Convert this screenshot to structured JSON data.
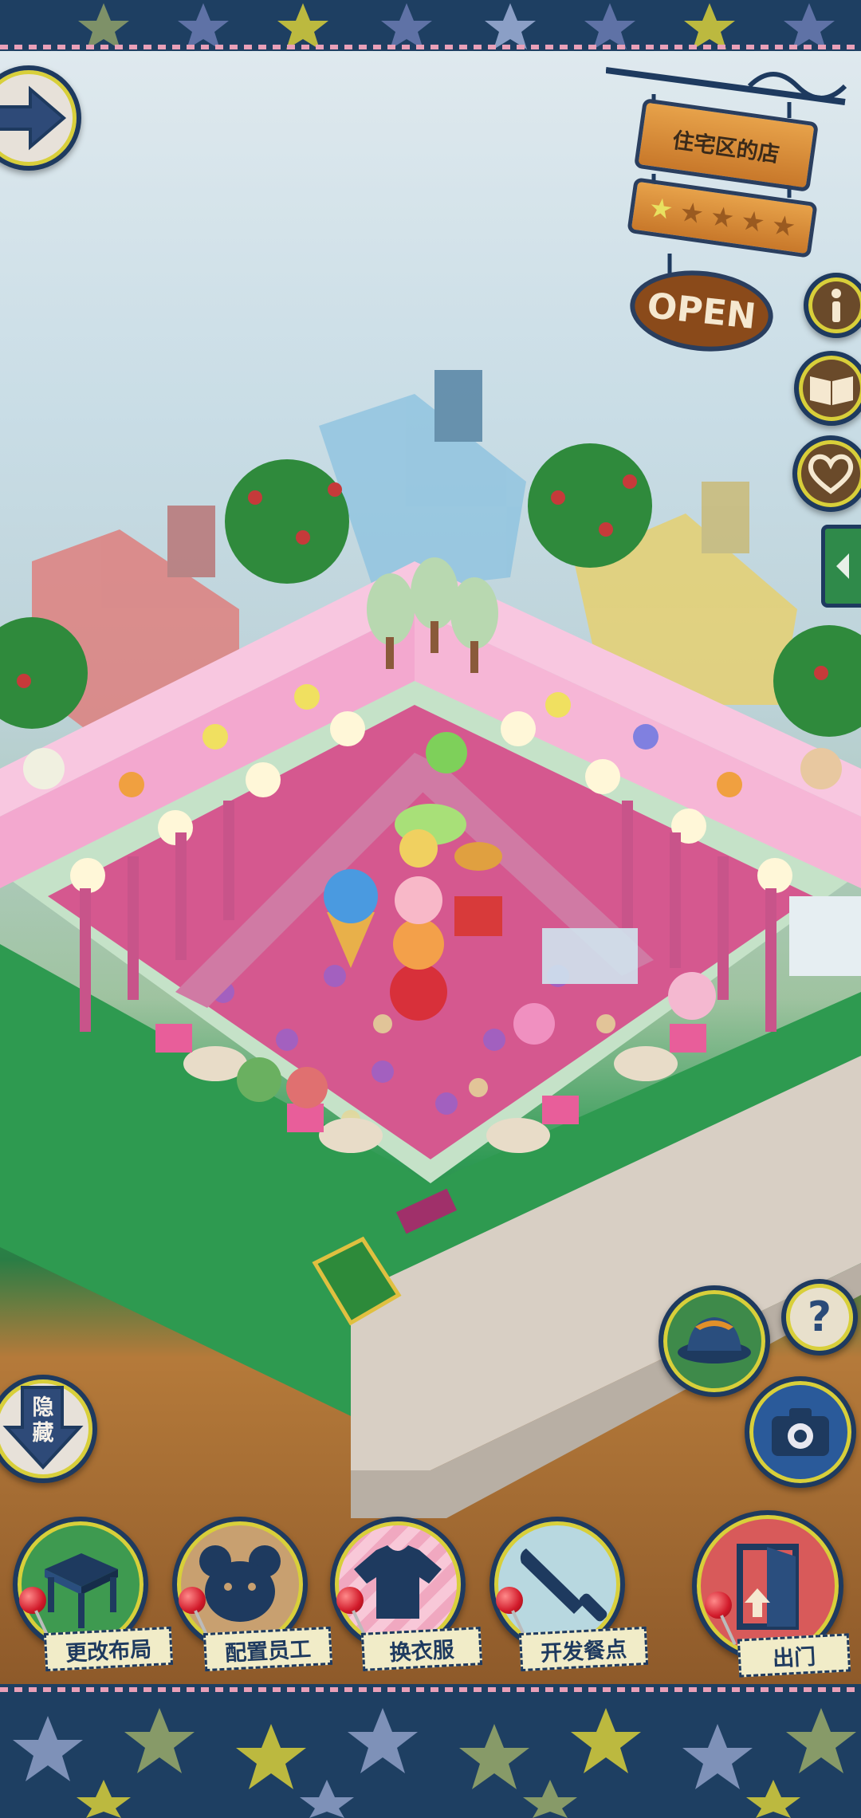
{
  "shop_sign": {
    "name": "住宅区的店",
    "open_label": "OPEN",
    "stars_filled": 1,
    "stars_total": 5
  },
  "buttons": {
    "layout": "更改布局",
    "staff": "配置员工",
    "costume": "换衣服",
    "develop_dishes": "开发餐点",
    "exit": "出门",
    "hide": "隐藏",
    "help": "?"
  },
  "colors": {
    "frame_navy": "#1e3a5f",
    "accent_yellow": "#d8cf3a",
    "pin_red": "#d11a2a",
    "shop_pink": "#f3a8cf",
    "grass_green": "#2f9a54"
  },
  "icons": {
    "back": "arrow-right-icon",
    "info": "info-icon",
    "menu_book": "book-icon",
    "favorite": "heart-icon",
    "side_tab": "chevron-left-icon",
    "hat": "hat-icon",
    "camera": "camera-icon"
  }
}
